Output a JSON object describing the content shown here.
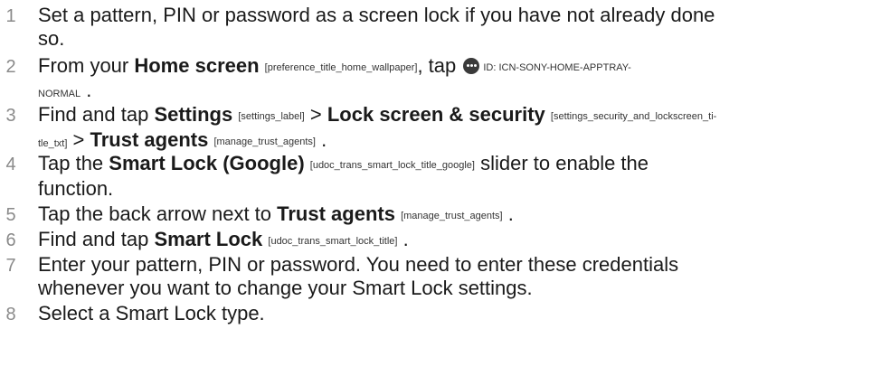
{
  "steps": [
    {
      "num": "1",
      "text": "Set a pattern, PIN or password as a screen lock if you have not already done",
      "text2": "so."
    },
    {
      "num": "2",
      "pre": "From your ",
      "term": "Home screen",
      "tag": "[preference_title_home_wallpaper]",
      "mid": ", tap ",
      "icon_name": "apptray-icon",
      "icon_tag": "ID: ICN-SONY-HOME-APPTRAY-",
      "icon_tag2": "NORMAL",
      "end": "."
    },
    {
      "num": "3",
      "pre": "Find and tap ",
      "term1": "Settings",
      "tag1": "[settings_label]",
      "sep1": ">",
      "term2": "Lock screen & security",
      "tag2a": "[settings_security_and_lockscreen_ti-",
      "tag2b": "tle_txt]",
      "sep2": ">",
      "term3": "Trust agents",
      "tag3": "[manage_trust_agents]",
      "end": "."
    },
    {
      "num": "4",
      "pre": "Tap the ",
      "term": "Smart Lock (Google)",
      "tag": "[udoc_trans_smart_lock_title_google]",
      "post": " slider to enable the",
      "line2": "function."
    },
    {
      "num": "5",
      "pre": "Tap the back arrow next to ",
      "term": "Trust agents",
      "tag": "[manage_trust_agents]",
      "end": "."
    },
    {
      "num": "6",
      "pre": "Find and tap ",
      "term": "Smart Lock",
      "tag": "[udoc_trans_smart_lock_title]",
      "end": "."
    },
    {
      "num": "7",
      "text": "Enter your pattern, PIN or password. You need to enter these credentials",
      "text2": "whenever you want to change your Smart Lock settings."
    },
    {
      "num": "8",
      "text": "Select a Smart Lock type."
    }
  ]
}
